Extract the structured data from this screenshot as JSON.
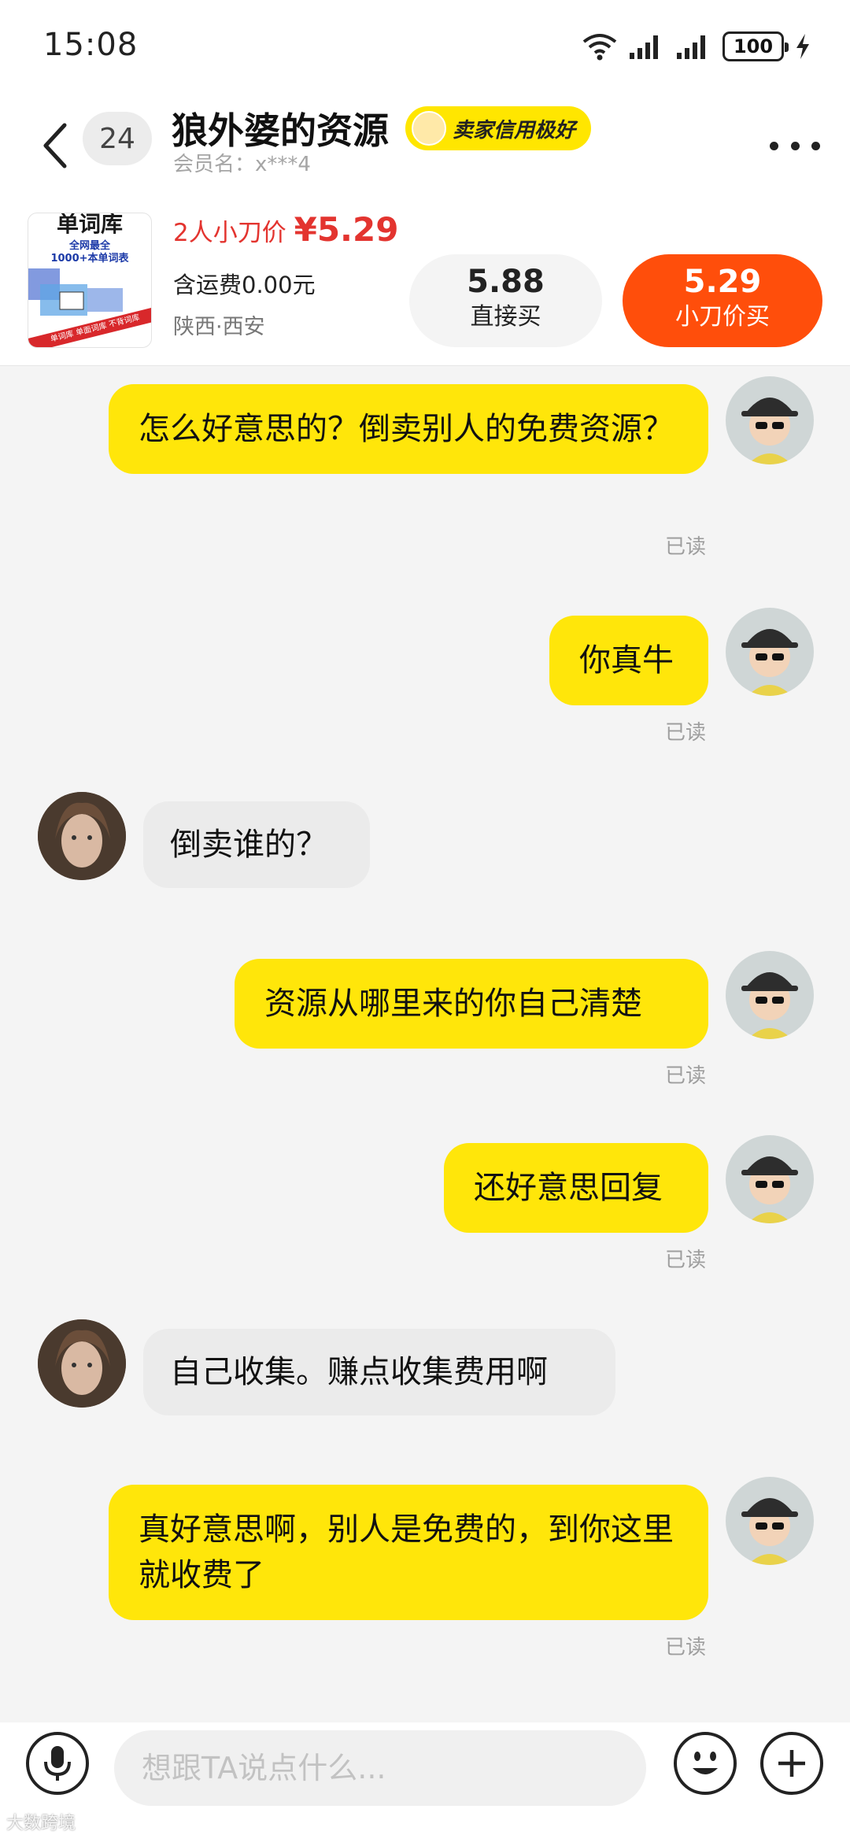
{
  "status_bar": {
    "time": "15:08",
    "battery": "100"
  },
  "header": {
    "back_icon": "chevron-left-icon",
    "unread_count": "24",
    "seller_name": "狼外婆的资源",
    "credit_badge": "卖家信用极好",
    "member_label": "会员名：x***4",
    "more_icon": "more-dots-icon"
  },
  "product": {
    "thumbnail": {
      "title": "单词库",
      "line1": "全网最全",
      "line2": "1000+本单词表",
      "strip_text": "单词库 单面词库 不背词库"
    },
    "price_prefix": "2人小刀价",
    "price": "¥5.29",
    "shipping": "含运费0.00元",
    "location": "陕西·西安",
    "direct_buy": {
      "price": "5.88",
      "label": "直接买"
    },
    "cut_buy": {
      "price": "5.29",
      "label": "小刀价买"
    }
  },
  "messages": [
    {
      "from": "me",
      "text": "怎么好意思的？倒卖别人的免费资源？",
      "status": "已读"
    },
    {
      "from": "me",
      "text": "你真牛",
      "status": "已读"
    },
    {
      "from": "other",
      "text": "倒卖谁的？"
    },
    {
      "from": "me",
      "text": "资源从哪里来的你自己清楚",
      "status": "已读"
    },
    {
      "from": "me",
      "text": "还好意思回复",
      "status": "已读"
    },
    {
      "from": "other",
      "text": "自己收集。赚点收集费用啊"
    },
    {
      "from": "me",
      "text": "真好意思啊，别人是免费的，到你这里就收费了",
      "status": "已读"
    }
  ],
  "input": {
    "placeholder": "想跟TA说点什么...",
    "voice_icon": "microphone-icon",
    "emoji_icon": "emoji-smile-icon",
    "plus_icon": "plus-icon"
  },
  "watermark": "大数跨境",
  "colors": {
    "bubble_me": "#ffe60a",
    "bubble_other": "#ebebeb",
    "accent_orange": "#ff4e0b",
    "price_red": "#e3342f"
  }
}
